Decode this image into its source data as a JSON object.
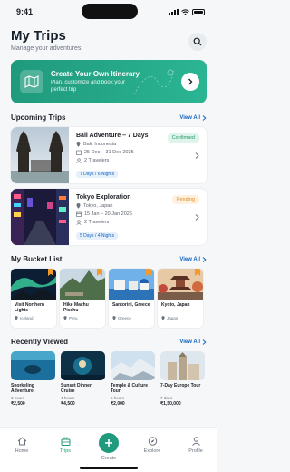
{
  "status": {
    "time": "9:41"
  },
  "header": {
    "title": "My Trips",
    "subtitle": "Manage your adventures",
    "search_icon": "search-icon"
  },
  "banner": {
    "title": "Create Your Own Itinerary",
    "description": "Plan, customize and book your perfect trip",
    "icon": "map-icon",
    "arrow_icon": "arrow-right-icon"
  },
  "upcoming": {
    "title": "Upcoming Trips",
    "view_all": "View All",
    "trips": [
      {
        "title": "Bali Adventure – 7 Days",
        "location": "Bali, Indonesia",
        "dates": "25 Dec – 31 Dec 2025",
        "travelers": "2 Travelers",
        "duration": "7 Days / 6 Nights",
        "status": "Confirmed",
        "status_color": "#1f9a6a"
      },
      {
        "title": "Tokyo Exploration",
        "location": "Tokyo, Japan",
        "dates": "15 Jan – 20 Jan 2026",
        "travelers": "2 Travelers",
        "duration": "5 Days / 4 Nights",
        "status": "Pending",
        "status_color": "#e08a1e"
      }
    ]
  },
  "bucket": {
    "title": "My Bucket List",
    "view_all": "View All",
    "items": [
      {
        "name": "Visit Northern Lights",
        "location": "Iceland"
      },
      {
        "name": "Hike Machu Picchu",
        "location": "Peru"
      },
      {
        "name": "Santorini, Greece",
        "location": "Greece"
      },
      {
        "name": "Kyoto, Japan",
        "location": "Japan"
      }
    ]
  },
  "recent": {
    "title": "Recently Viewed",
    "view_all": "View All",
    "items": [
      {
        "name": "Snorkeling Adventure",
        "duration": "3 hours",
        "price": "₹2,500"
      },
      {
        "name": "Sunset Dinner Cruise",
        "duration": "4 hours",
        "price": "₹4,500"
      },
      {
        "name": "Temple & Culture Tour",
        "duration": "5 hours",
        "price": "₹2,000"
      },
      {
        "name": "7-Day Europe Tour",
        "duration": "7 days",
        "price": "₹1,50,000"
      }
    ]
  },
  "tabs": [
    {
      "label": "Home",
      "icon": "home-icon"
    },
    {
      "label": "Trips",
      "icon": "suitcase-icon"
    },
    {
      "label": "Create",
      "icon": "plus-icon"
    },
    {
      "label": "Explore",
      "icon": "compass-icon"
    },
    {
      "label": "Profile",
      "icon": "user-icon"
    }
  ],
  "colors": {
    "accent": "#1f9a7c",
    "link": "#1565c0",
    "bookmark": "#f39a2b"
  }
}
